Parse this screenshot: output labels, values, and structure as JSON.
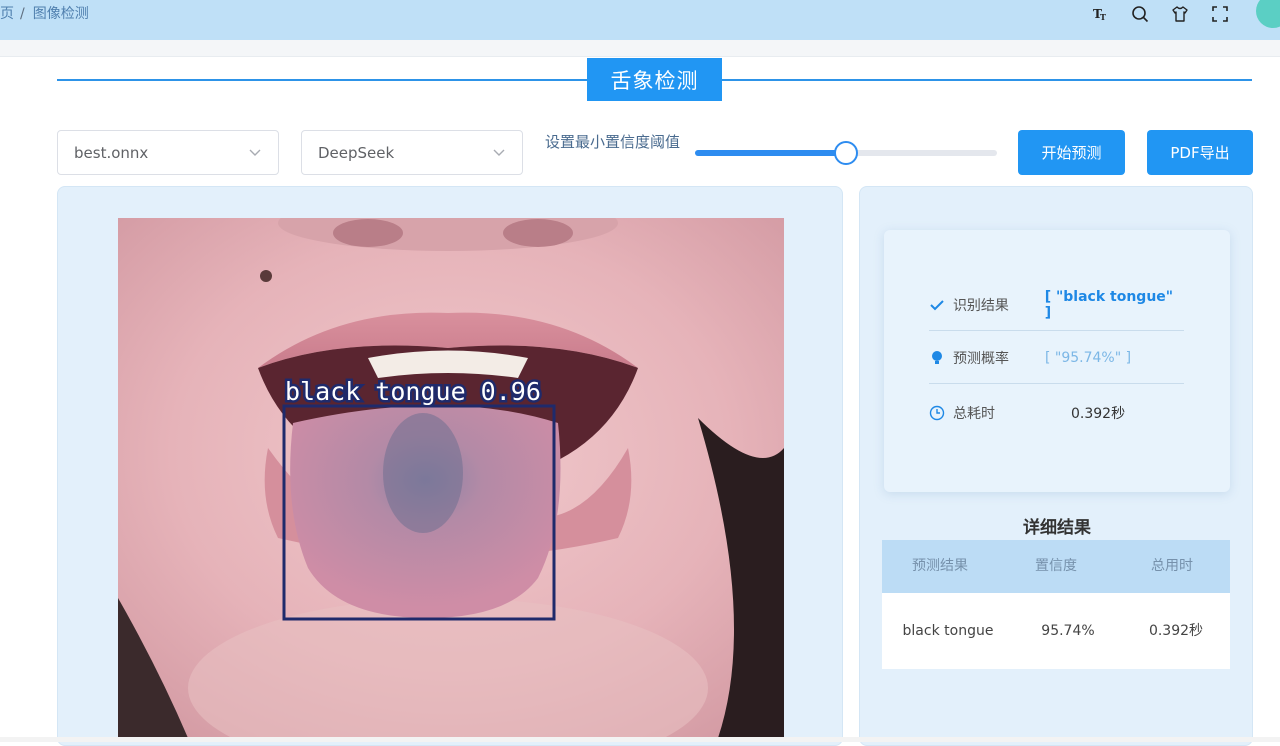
{
  "breadcrumb": {
    "home": "页",
    "separator": "/",
    "current": "图像检测"
  },
  "header_icons": [
    "font-size-icon",
    "search-icon",
    "shirt-icon",
    "fullscreen-icon"
  ],
  "title": "舌象检测",
  "controls": {
    "model_select": "best.onnx",
    "llm_select": "DeepSeek",
    "threshold_label": "设置最小置信度阈值",
    "threshold_value": 0.5,
    "start_button": "开始预测",
    "pdf_button": "PDF导出"
  },
  "detection": {
    "label": "black tongue 0.96"
  },
  "summary": {
    "result_label": "识别结果",
    "result_value": "[ \"black tongue\" ]",
    "prob_label": "预测概率",
    "prob_value": "[ \"95.74%\" ]",
    "time_label": "总耗时",
    "time_value": "0.392秒"
  },
  "detail": {
    "title": "详细结果",
    "headers": [
      "预测结果",
      "置信度",
      "总用时"
    ],
    "rows": [
      [
        "black tongue",
        "95.74%",
        "0.392秒"
      ]
    ]
  },
  "colors": {
    "accent": "#2196f3",
    "header_bg": "#bfe0f7",
    "panel_bg": "#e3f0fb",
    "bbox": "#1f2a6b"
  }
}
